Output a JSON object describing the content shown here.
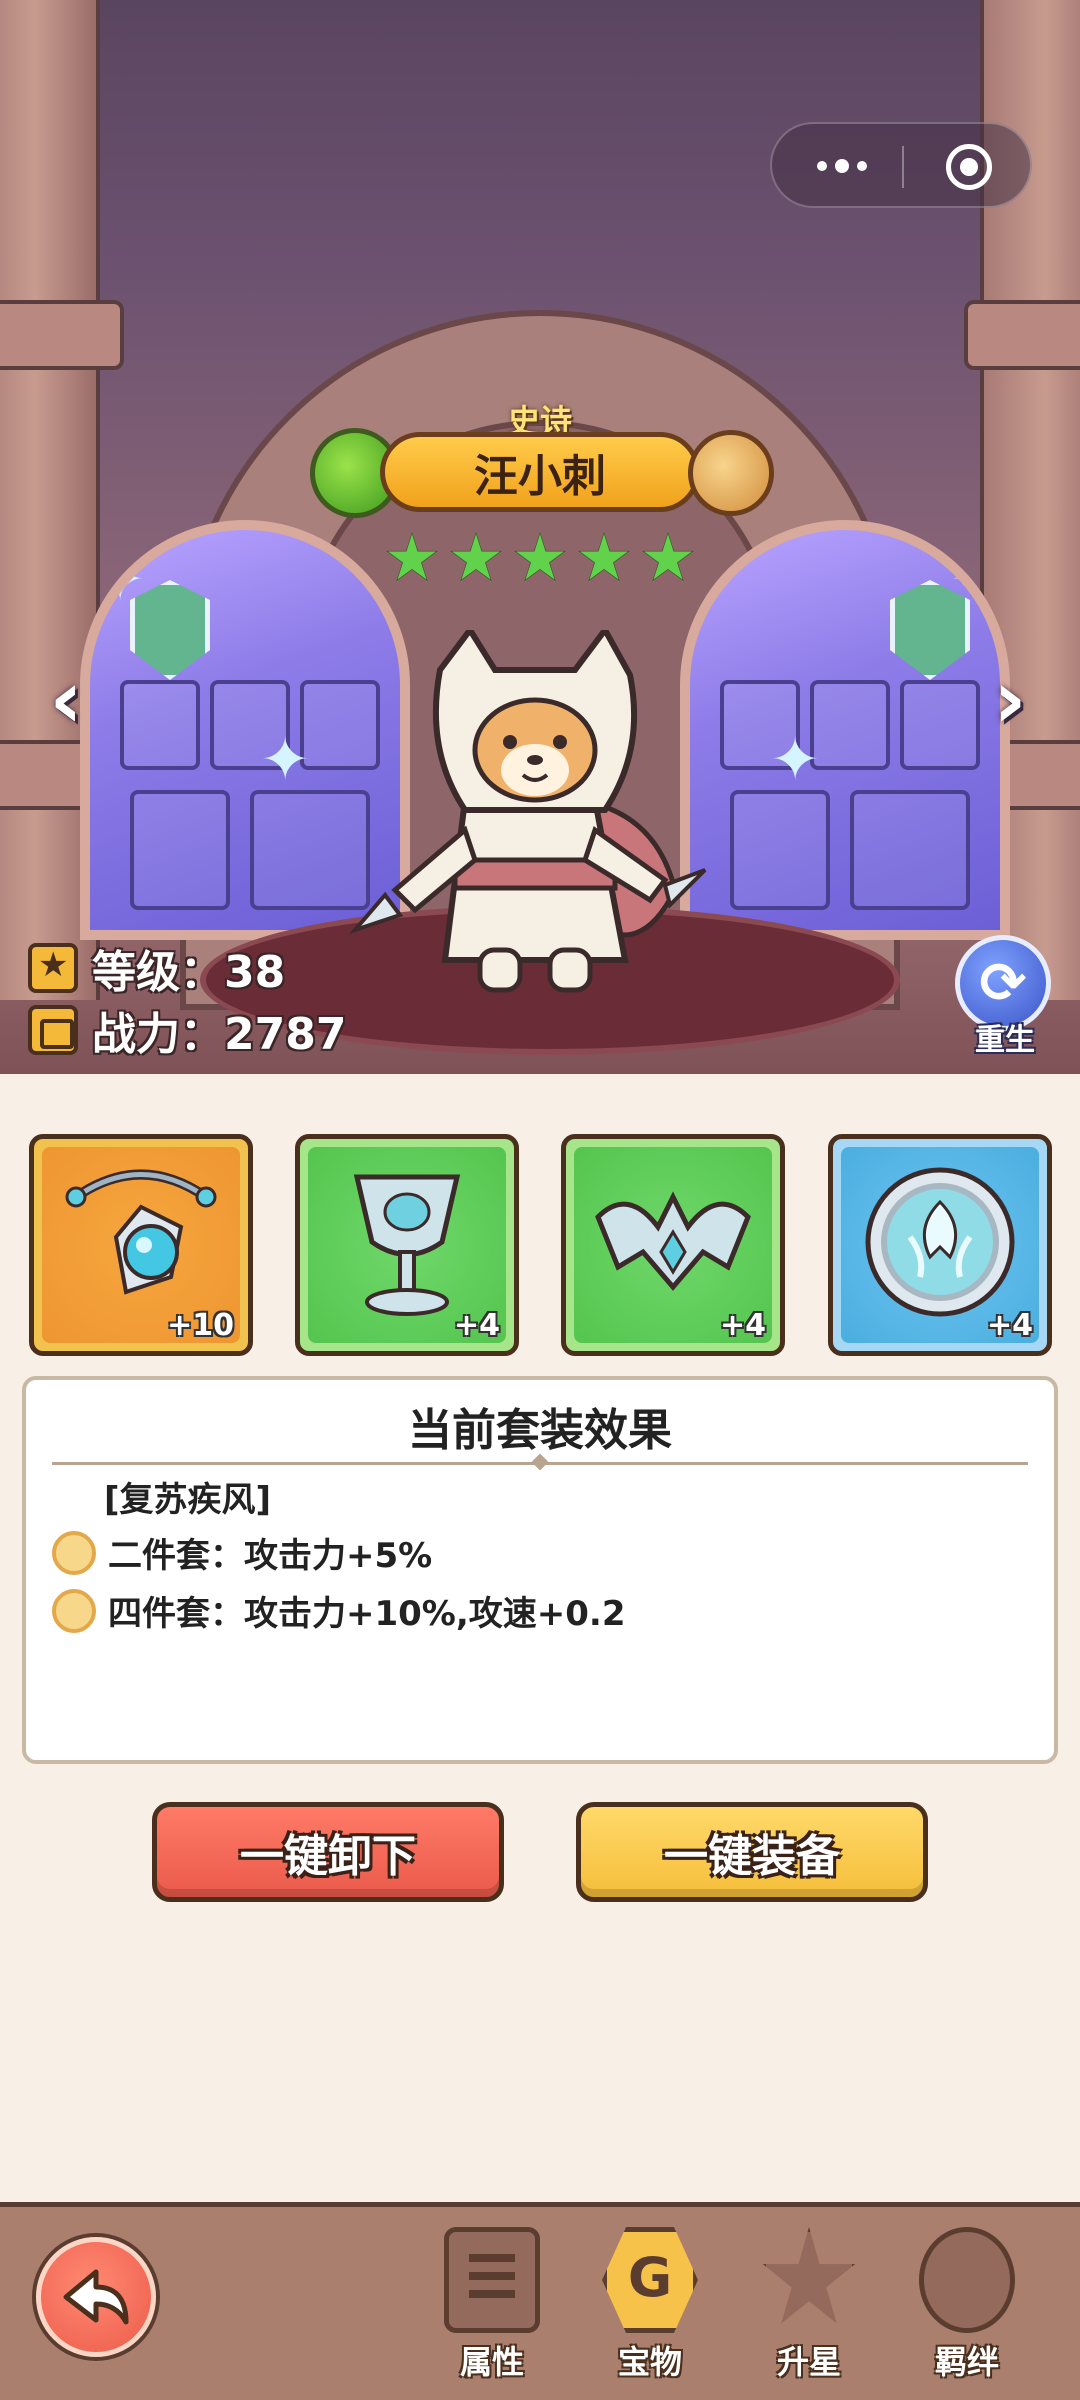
{
  "hero": {
    "rarity": "史诗",
    "name": "汪小刺",
    "stars": 5,
    "level_text": "等级：38",
    "power_text": "战力：2787",
    "rebirth_label": "重生"
  },
  "nav_arrows": {
    "left": "‹",
    "right": "›"
  },
  "equipment": [
    {
      "name": "necklace",
      "rarity_color": "orange",
      "level": "+10"
    },
    {
      "name": "chalice",
      "rarity_color": "green",
      "level": "+4"
    },
    {
      "name": "crown",
      "rarity_color": "green",
      "level": "+4"
    },
    {
      "name": "medallion",
      "rarity_color": "blue",
      "level": "+4"
    }
  ],
  "set_panel": {
    "title": "当前套装效果",
    "set_name": "[复苏疾风]",
    "effects": [
      "二件套：攻击力+5%",
      "四件套：攻击力+10%,攻速+0.2"
    ]
  },
  "buttons": {
    "unequip": "一键卸下",
    "equip": "一键装备"
  },
  "bottom_nav": {
    "active": "宝物",
    "items": [
      "属性",
      "宝物",
      "升星",
      "羁绊"
    ]
  },
  "colors": {
    "page_bg": "#f8f0e6",
    "unequip_btn": "#ea5a4b",
    "equip_btn": "#f5be3a",
    "star_green": "#62d24d",
    "nav_bar": "#ab7f6e"
  }
}
